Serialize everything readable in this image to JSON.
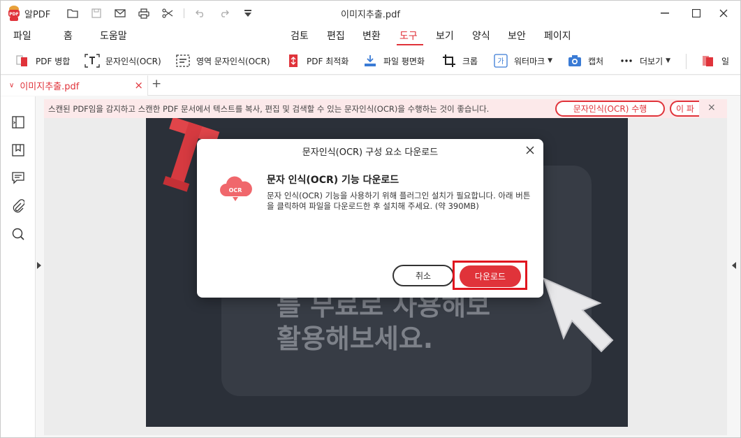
{
  "titlebar": {
    "app_name": "알PDF",
    "document_title": "이미지추출.pdf"
  },
  "menu": {
    "left": [
      "파일",
      "홈",
      "도움말"
    ],
    "main": [
      "검토",
      "편집",
      "변환",
      "도구",
      "보기",
      "양식",
      "보안",
      "페이지"
    ],
    "active": "도구"
  },
  "toolbar": {
    "items": [
      "PDF 병합",
      "문자인식(OCR)",
      "영역 문자인식(OCR)",
      "PDF 최적화",
      "파일 평면화",
      "크롭",
      "워터마크",
      "캡처",
      "더보기",
      "일"
    ]
  },
  "tab": {
    "name": "이미지추출.pdf",
    "add_label": "+"
  },
  "notice": {
    "text": "스캔된 PDF임을 감지하고 스캔한 PDF 문서에서 텍스트를 복사, 편집 및 검색할 수 있는 문자인식(OCR)을 수행하는 것이 좋습니다.",
    "ocr_button": "문자인식(OCR) 수행",
    "second_button": "이 파"
  },
  "page": {
    "line1": "를 무료로 사용해보",
    "line2": "활용해보세요."
  },
  "dialog": {
    "title": "문자인식(OCR) 구성 요소 다운로드",
    "icon_label": "OCR",
    "heading": "문자 인식(OCR) 기능 다운로드",
    "body": "문자 인식(OCR) 기능을 사용하기 위해 플러그인 설치가 필요합니다. 아래 버튼을 클릭하여 파일을 다운로드한 후 설치해 주세요. (약 390MB)",
    "cancel_label": "취소",
    "download_label": "다운로드"
  },
  "colors": {
    "accent": "#e0333a",
    "notice_bg": "#fce9ea",
    "page_bg": "#2b3039"
  }
}
